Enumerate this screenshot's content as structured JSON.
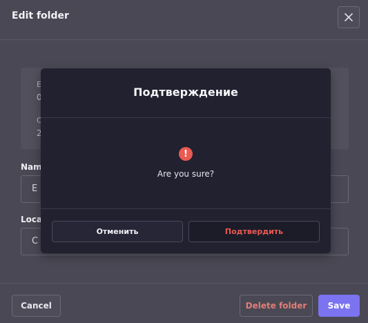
{
  "background_modal": {
    "title": "Edit folder",
    "close_icon": "close-icon",
    "info_label_1": "E",
    "info_value_1": "0",
    "info_label_2": "C",
    "info_value_2": "2",
    "name_label": "Name",
    "name_value": "E",
    "location_label": "Loca",
    "location_value": "C",
    "cancel_label": "Cancel",
    "delete_label": "Delete folder",
    "save_label": "Save"
  },
  "confirm_dialog": {
    "title": "Подтверждение",
    "warning_icon": "exclamation-icon",
    "warning_glyph": "!",
    "message": "Are you sure?",
    "cancel_label": "Отменить",
    "confirm_label": "Подтвердить"
  },
  "colors": {
    "accent": "#7b73f0",
    "danger": "#e85a52",
    "dialog_bg": "#212130"
  }
}
